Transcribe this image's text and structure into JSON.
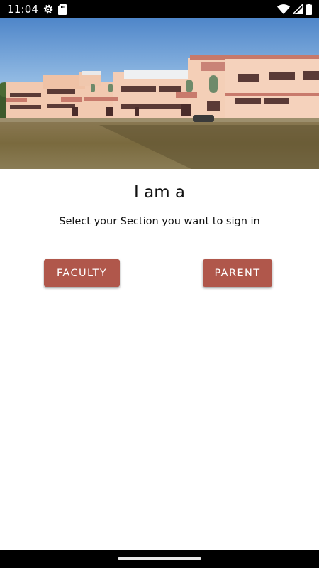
{
  "status_bar": {
    "time": "11:04",
    "icons": [
      "settings-gear-icon",
      "sd-card-icon",
      "wifi-icon",
      "signal-icon",
      "battery-icon"
    ]
  },
  "hero": {
    "image": "school-building-photo"
  },
  "content": {
    "heading": "I am a",
    "subheading": "Select your Section you want to sign in"
  },
  "buttons": {
    "faculty_label": "FACULTY",
    "parent_label": "PARENT"
  },
  "colors": {
    "button": "#b0574b",
    "status_bar": "#000000",
    "background": "#ffffff"
  }
}
